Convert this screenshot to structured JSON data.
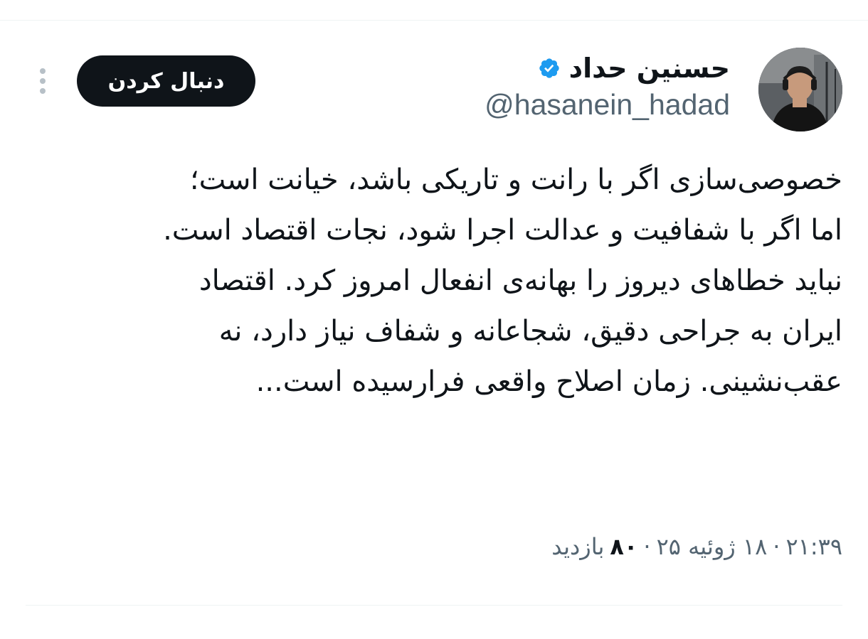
{
  "tweet": {
    "author": {
      "display_name": "حسنین حداد",
      "handle": "@hasanein_hadad",
      "verified": true,
      "verified_color": "#1d9bf0"
    },
    "follow_button_label": "دنبال کردن",
    "lines": [
      "خصوصی‌سازی اگر با رانت و تاریکی باشد، خیانت است؛",
      "اما اگر با شفافیت و عدالت اجرا شود، نجات اقتصاد است.",
      "نباید خطاهای دیروز را بهانه‌ی انفعال امروز کرد. اقتصاد",
      "ایران به جراحی دقیق، شجاعانه و شفاف نیاز دارد، نه",
      "عقب‌نشینی. زمان اصلاح واقعی فرارسیده است..."
    ],
    "meta": {
      "time": "۲۱:۳۹",
      "date": "۱۸ ژوئیه ۲۵",
      "separator": "·",
      "views_count": "۸۰",
      "views_label": "بازدید"
    }
  },
  "icons": {
    "more": "more-vertical-icon",
    "verified": "verified-badge-icon"
  },
  "colors": {
    "text_primary": "#0f1419",
    "text_secondary": "#536471",
    "button_bg": "#0f1419",
    "divider": "#eff3f4"
  }
}
